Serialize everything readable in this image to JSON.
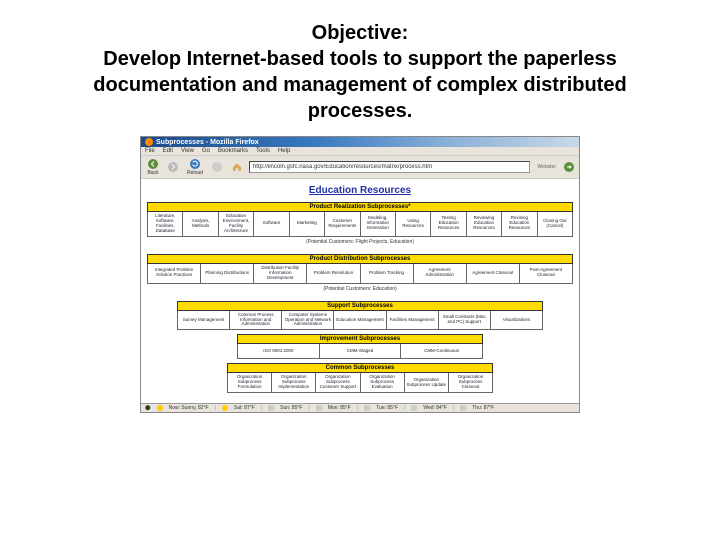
{
  "slide": {
    "title_line1": "Objective:",
    "title_rest": "Develop Internet-based tools to support the paperless documentation and management of complex distributed processes."
  },
  "browser": {
    "title": "Subprocesses - Mozilla Firefox",
    "menu": [
      "File",
      "Edit",
      "View",
      "Go",
      "Bookmarks",
      "Tools",
      "Help"
    ],
    "toolbar": {
      "back": "Back",
      "reload": "Reload",
      "url": "http://lincoln.gsfc.nasa.gov/Education/resources/matrix/process.htm",
      "webster": "Webster"
    }
  },
  "page": {
    "heading": "Education Resources",
    "sections": [
      {
        "bar": "Product Realization Subprocesses*",
        "cells": [
          "Literature, Software, Facilities, Database",
          "Analysis, Methods",
          "Education Environment, Facility Architecture",
          "Software",
          "Marketing",
          "Customer Requirements",
          "Modeling, Information Generation",
          "Using Resources",
          "Testing Education Resources",
          "Reviewing Education Resources",
          "Revising Education Resources",
          "Closing Out (Cancel)"
        ],
        "caption": "(Potential Customers: Flight Projects, Education)"
      },
      {
        "bar": "Product Distribution Subprocesses",
        "cells": [
          "Integrated Problem Solution Practices",
          "Planning Distributions",
          "Distribution Facility Information Development",
          "Problem Resolution",
          "Problem Tracking",
          "Agreement Administration",
          "Agreement Closeout",
          "Post-Agreement Closeout"
        ],
        "caption": "(Potential Customers: Education)"
      },
      {
        "bar": "Support Subprocesses",
        "cells": [
          "Survey Management",
          "Common Process Information and Administration",
          "Computer Systems Operation and Network Administration",
          "Education Management",
          "Facilities Management",
          "Small Contracts (Mac and PC) Support",
          "Visualizations"
        ],
        "caption": ""
      },
      {
        "bar": "Improvement Subprocesses",
        "cells": [
          "ISO 9001:2000",
          "CMM-Staged",
          "CMM-Continuous"
        ],
        "caption": ""
      },
      {
        "bar": "Common Subprocesses",
        "cells": [
          "Organization Subprocess Formulation",
          "Organization Subprocess Implementation",
          "Organization Subprocess Customer Support",
          "Organization Subprocess Evaluation",
          "Organization Subprocess Update",
          "Organization Subprocess Closeout"
        ],
        "caption": ""
      }
    ]
  },
  "statusbar": {
    "items": [
      "Now: Sunny, 82°F",
      "Sat: 87°F",
      "Sun: 85°F",
      "Mon: 85°F",
      "Tue: 85°F",
      "Wed: 84°F",
      "Thu: 87°F"
    ]
  }
}
